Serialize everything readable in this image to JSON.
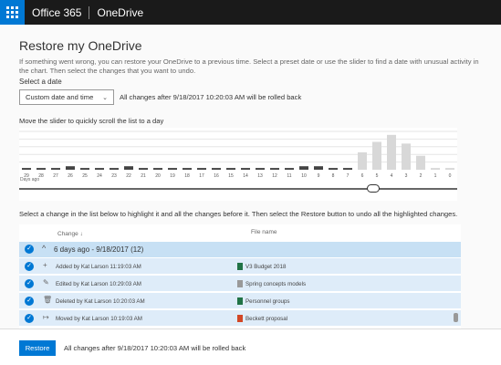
{
  "topbar": {
    "brand": "Office 365",
    "app": "OneDrive"
  },
  "page": {
    "title": "Restore my OneDrive",
    "description": "If something went wrong, you can restore your OneDrive to a previous time. Select a preset date or use the slider to find a date with unusual activity in the chart. Then select the changes that you want to undo.",
    "select_label": "Select a date",
    "date_option": "Custom date and time",
    "rollback_note": "All changes after 9/18/2017 10:20:03 AM will be rolled back",
    "slider_label": "Move the slider to quickly scroll the list to a day",
    "days_ago_label": "Days ago",
    "instructions": "Select a change in the list below to highlight it and all the changes before it. Then select the Restore button to undo all the highlighted changes."
  },
  "chart_data": {
    "type": "bar",
    "categories": [
      "29",
      "28",
      "27",
      "26",
      "25",
      "24",
      "23",
      "22",
      "21",
      "20",
      "19",
      "18",
      "17",
      "16",
      "15",
      "14",
      "13",
      "12",
      "11",
      "10",
      "9",
      "8",
      "7",
      "6",
      "5",
      "4",
      "3",
      "2",
      "1",
      "0"
    ],
    "values": [
      1,
      1,
      1,
      2,
      1,
      1,
      1,
      2,
      1,
      1,
      1,
      1,
      1,
      1,
      1,
      1,
      1,
      1,
      1,
      2,
      2,
      1,
      1,
      10,
      16,
      20,
      15,
      8,
      1,
      1
    ],
    "ylim": [
      0,
      22
    ],
    "xlabel": "Days ago",
    "highlight_from_index": 23,
    "colors": {
      "bar": "#444444",
      "bar_highlight": "#d8d8d8",
      "grid": "#e6e6e6"
    },
    "grid": true
  },
  "list": {
    "columns": {
      "change": "Change ↓",
      "file": "File name"
    },
    "group": "6 days ago - 9/18/2017 (12)",
    "rows": [
      {
        "action": "Added by Kat Larson 11:19:03 AM",
        "icon": "plus-icon",
        "file": "V3 Budget 2018",
        "file_icon": "excel-file-icon"
      },
      {
        "action": "Edited by Kat Larson 10:29:03 AM",
        "icon": "edit-icon",
        "file": "Spring concepts models",
        "file_icon": "generic-file-icon"
      },
      {
        "action": "Deleted by Kat Larson 10:20:03 AM",
        "icon": "trash-icon",
        "file": "Personnel groups",
        "file_icon": "excel-file-icon"
      },
      {
        "action": "Moved by Kat Larson 10:19:03 AM",
        "icon": "move-icon",
        "file": "Beckett proposal",
        "file_icon": "powerpoint-file-icon"
      }
    ]
  },
  "footer": {
    "restore_label": "Restore",
    "note": "All changes after 9/18/2017 10:20:03 AM will be rolled back"
  },
  "colors": {
    "accent": "#0078d4",
    "selected_row": "#deecf9",
    "group_row": "#c7e0f4",
    "topbar": "#1a1a1a"
  }
}
